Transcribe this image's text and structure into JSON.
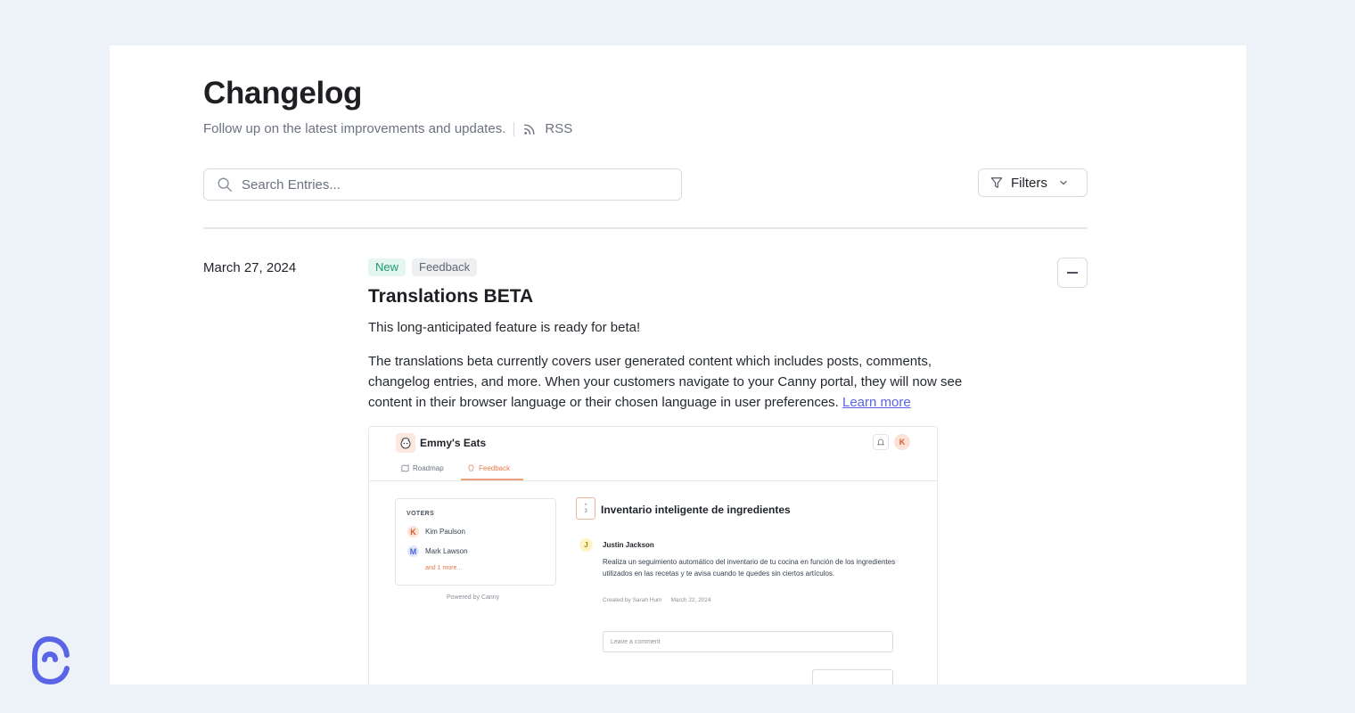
{
  "header": {
    "title": "Changelog",
    "subtitle": "Follow up on the latest improvements and updates.",
    "rss_label": "RSS"
  },
  "search": {
    "placeholder": "Search Entries..."
  },
  "filters": {
    "label": "Filters"
  },
  "entry": {
    "date": "March 27, 2024",
    "tags": [
      "New",
      "Feedback"
    ],
    "title": "Translations BETA",
    "paragraph1": "This long-anticipated feature is ready for beta!",
    "paragraph2": "The translations beta currently covers user generated content which includes posts, comments, changelog entries, and more. When your customers navigate to your Canny portal, they will now see content in their browser language or their chosen language in user preferences.",
    "learn_more": "Learn more"
  },
  "embedded": {
    "brand": "Emmy's Eats",
    "avatar_letter": "K",
    "tabs": [
      "Roadmap",
      "Feedback"
    ],
    "voters_title": "VOTERS",
    "voters": [
      {
        "initial": "K",
        "name": "Kim Paulson"
      },
      {
        "initial": "M",
        "name": "Mark Lawson"
      }
    ],
    "voters_more": "and 1 more...",
    "powered_by": "Powered by Canny",
    "vote_count": "3",
    "post_title": "Inventario inteligente de ingredientes",
    "commenter_initial": "J",
    "commenter_name": "Justin Jackson",
    "post_body": "Realiza un seguimiento automático del inventario de tu cocina en función de los ingredientes utilizados en las recetas y te avisa cuando te quedes sin ciertos artículos.",
    "created_by": "Created by Sarah Hum",
    "created_date": "March 22, 2024",
    "comment_placeholder": "Leave a comment"
  },
  "colors": {
    "background": "#edf1f8",
    "accent": "#5a64e6",
    "tag_new": "#1d9a6c",
    "feedback_orange": "#e47b4d"
  }
}
